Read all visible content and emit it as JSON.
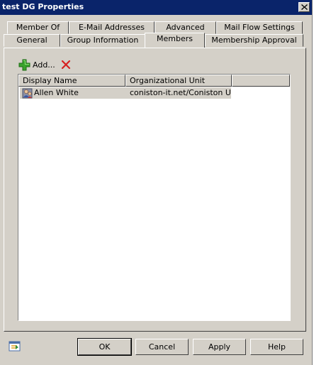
{
  "window": {
    "title": "test DG Properties"
  },
  "tabs": {
    "row1": [
      {
        "label": "Member Of"
      },
      {
        "label": "E-Mail Addresses"
      },
      {
        "label": "Advanced"
      },
      {
        "label": "Mail Flow Settings"
      }
    ],
    "row2": [
      {
        "label": "General"
      },
      {
        "label": "Group Information"
      },
      {
        "label": "Members",
        "active": true
      },
      {
        "label": "Membership Approval"
      }
    ]
  },
  "toolbar": {
    "add_label": "Add..."
  },
  "list": {
    "columns": [
      "Display Name",
      "Organizational Unit"
    ],
    "rows": [
      {
        "display_name": "Allen White",
        "ou": "coniston-it.net/Coniston Us..."
      }
    ]
  },
  "buttons": {
    "ok": "OK",
    "cancel": "Cancel",
    "apply": "Apply",
    "help": "Help"
  },
  "colors": {
    "titlebar": "#0a246a",
    "face": "#d4d0c8",
    "add_green": "#3aa32c",
    "remove_red": "#d62020"
  },
  "icons": [
    "close-icon",
    "add-icon",
    "remove-icon",
    "user-icon",
    "properties-status-icon"
  ]
}
